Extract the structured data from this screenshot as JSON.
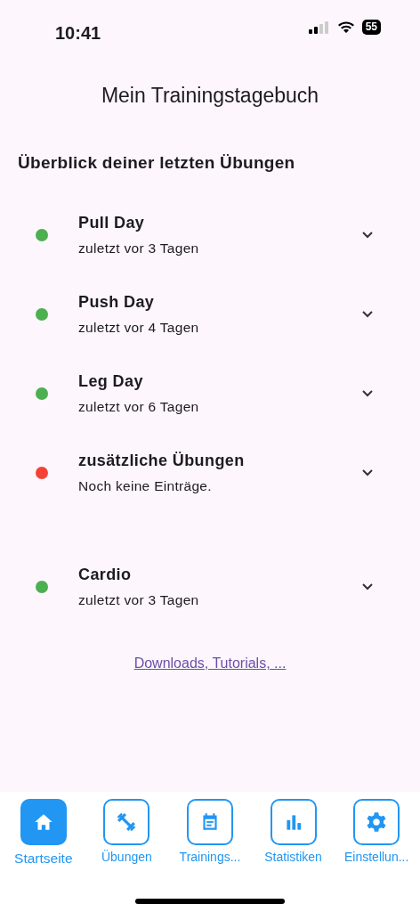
{
  "status_bar": {
    "time": "10:41",
    "battery": "55"
  },
  "title": "Mein Trainingstagebuch",
  "section_heading": "Überblick deiner letzten Übungen",
  "workouts": [
    {
      "name": "Pull Day",
      "subtitle": "zuletzt vor 3 Tagen",
      "color": "#4caf50",
      "expanded": false
    },
    {
      "name": "Push Day",
      "subtitle": "zuletzt vor 4 Tagen",
      "color": "#4caf50",
      "expanded": false
    },
    {
      "name": "Leg Day",
      "subtitle": "zuletzt vor 6 Tagen",
      "color": "#4caf50",
      "expanded": false
    },
    {
      "name": "zusätzliche Übungen",
      "subtitle": "Noch keine Einträge.",
      "color": "#f44336",
      "expanded": false
    },
    {
      "name": "Cardio",
      "subtitle": "zuletzt vor 3 Tagen",
      "color": "#4caf50",
      "expanded": false
    }
  ],
  "link": "Downloads, Tutorials, ...",
  "bottom_nav": [
    {
      "label": "Startseite",
      "kind": "home",
      "selected": true
    },
    {
      "label": "Übungen",
      "kind": "dumbbell",
      "selected": false
    },
    {
      "label": "Trainings...",
      "kind": "calendar",
      "selected": false
    },
    {
      "label": "Statistiken",
      "kind": "chart",
      "selected": false
    },
    {
      "label": "Einstellun...",
      "kind": "gear",
      "selected": false
    }
  ]
}
